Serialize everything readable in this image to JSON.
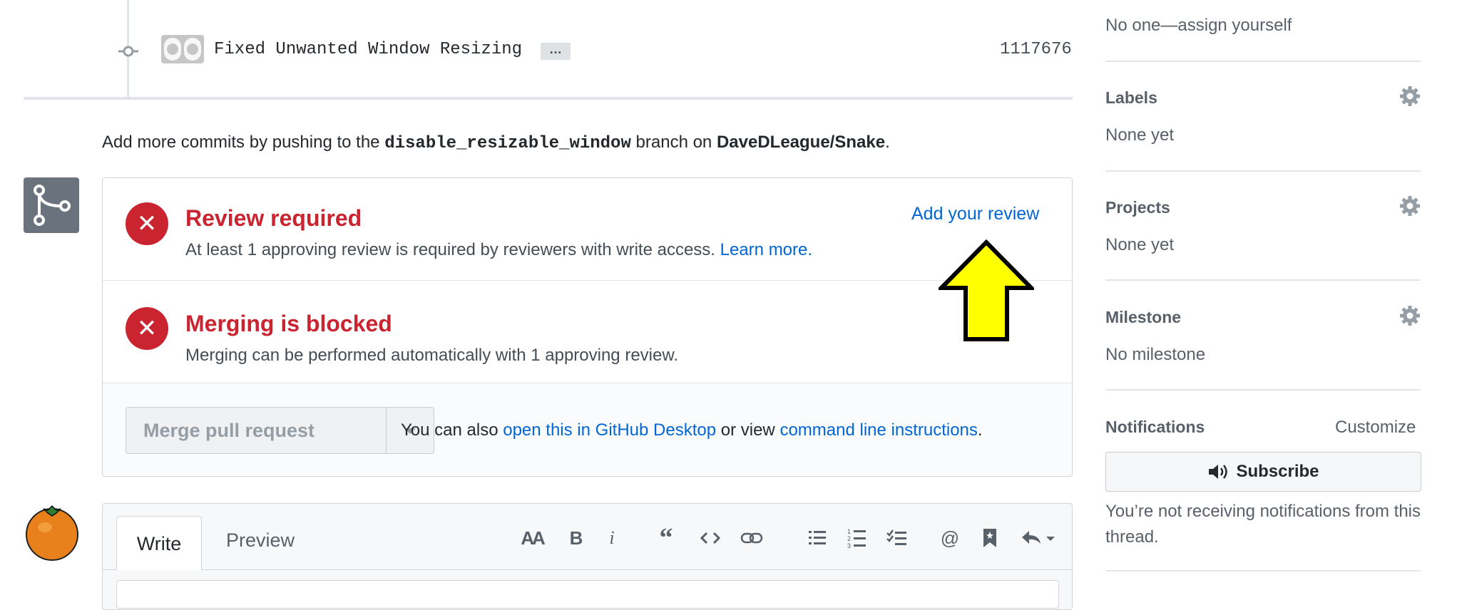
{
  "commit": {
    "message": "Fixed Unwanted Window Resizing",
    "ellipsis": "…",
    "sha": "1117676"
  },
  "push_hint": {
    "prefix": "Add more commits by pushing to the",
    "branch": "disable_resizable_window",
    "middle": "branch on",
    "repo": "DaveDLeague/Snake",
    "suffix": "."
  },
  "merge_box": {
    "review": {
      "title": "Review required",
      "description": "At least 1 approving review is required by reviewers with write access.",
      "learn_more": "Learn more.",
      "action": "Add your review"
    },
    "blocked": {
      "title": "Merging is blocked",
      "description": "Merging can be performed automatically with 1 approving review."
    },
    "merge_button": "Merge pull request",
    "hint": {
      "prefix": "You can also",
      "desktop_link": "open this in GitHub Desktop",
      "middle": "or view",
      "cli_link": "command line instructions",
      "suffix": "."
    },
    "status_color": "#cb2431"
  },
  "editor": {
    "tabs": [
      "Write",
      "Preview"
    ],
    "toolbar_icons": [
      "text-size-icon",
      "bold-icon",
      "italic-icon",
      "quote-icon",
      "code-icon",
      "link-icon",
      "unordered-list-icon",
      "ordered-list-icon",
      "task-list-icon",
      "mention-icon",
      "bookmark-icon",
      "reply-icon"
    ]
  },
  "sidebar": {
    "assignees_text": "No one—assign yourself",
    "labels": {
      "title": "Labels",
      "value": "None yet"
    },
    "projects": {
      "title": "Projects",
      "value": "None yet"
    },
    "milestone": {
      "title": "Milestone",
      "value": "No milestone"
    },
    "notifications": {
      "title": "Notifications",
      "customize": "Customize",
      "subscribe": "Subscribe",
      "note": "You’re not receiving notifications from this thread."
    }
  },
  "annotation": {
    "arrow_color": "#ffff00"
  }
}
